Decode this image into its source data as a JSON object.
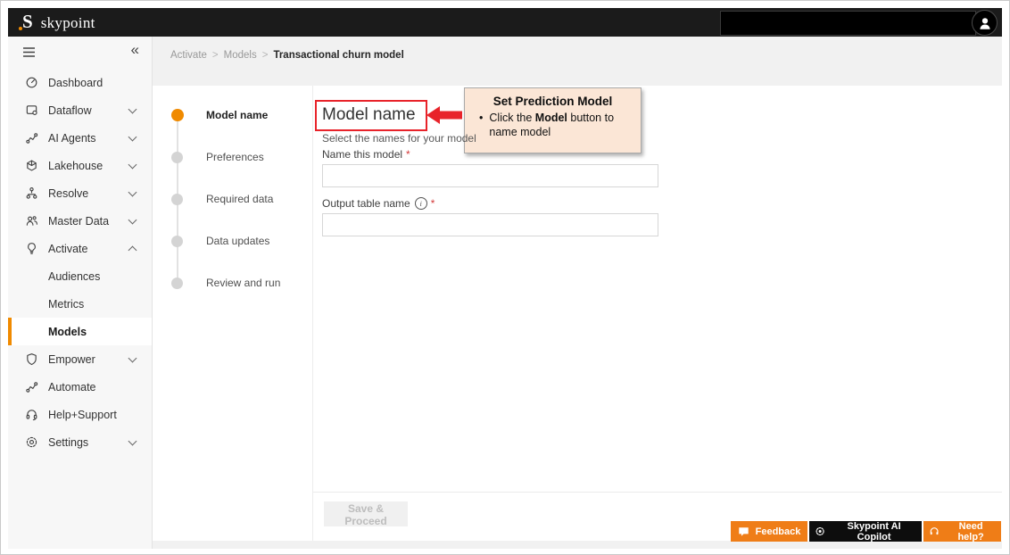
{
  "topbar": {
    "logo": {
      "initial": "S",
      "name": "skypoint"
    }
  },
  "breadcrumb": {
    "link1": "Activate",
    "link2": "Models",
    "separator": ">",
    "current": "Transactional churn model"
  },
  "sidebar": {
    "items": [
      {
        "label": "Dashboard"
      },
      {
        "label": "Dataflow"
      },
      {
        "label": "AI Agents"
      },
      {
        "label": "Lakehouse"
      },
      {
        "label": "Resolve"
      },
      {
        "label": "Master Data"
      },
      {
        "label": "Activate"
      },
      {
        "label": "Audiences"
      },
      {
        "label": "Metrics"
      },
      {
        "label": "Models"
      },
      {
        "label": "Empower"
      },
      {
        "label": "Automate"
      },
      {
        "label": "Help+Support"
      },
      {
        "label": "Settings"
      }
    ]
  },
  "stepper": {
    "steps": [
      {
        "label": "Model name",
        "state": "active"
      },
      {
        "label": "Preferences",
        "state": "pending"
      },
      {
        "label": "Required data",
        "state": "pending"
      },
      {
        "label": "Data updates",
        "state": "pending"
      },
      {
        "label": "Review and run",
        "state": "pending"
      }
    ]
  },
  "form": {
    "title": "Model name",
    "subtitle": "Select the names for your model",
    "fields": [
      {
        "label": "Name this model",
        "required_mark": "*",
        "value": "",
        "placeholder": ""
      },
      {
        "label": "Output table name",
        "required_mark": "*",
        "info_icon": "info-icon",
        "value": "",
        "placeholder": ""
      }
    ],
    "save_button": "Save & Proceed"
  },
  "annotation": {
    "title": "Set Prediction Model",
    "bullet": "•",
    "line1_pre": "Click the ",
    "line1_bold": "Model",
    "line1_post": " button to name model"
  },
  "footer_buttons": {
    "feedback": "Feedback",
    "copilot": "Skypoint AI Copilot",
    "help": "Need help?"
  },
  "colors": {
    "accent_orange": "#f08a00",
    "button_orange": "#ef7d17",
    "annotation_red": "#e8232a",
    "callout_bg": "#fbe6d6",
    "topbar_black": "#1b1b1b"
  }
}
